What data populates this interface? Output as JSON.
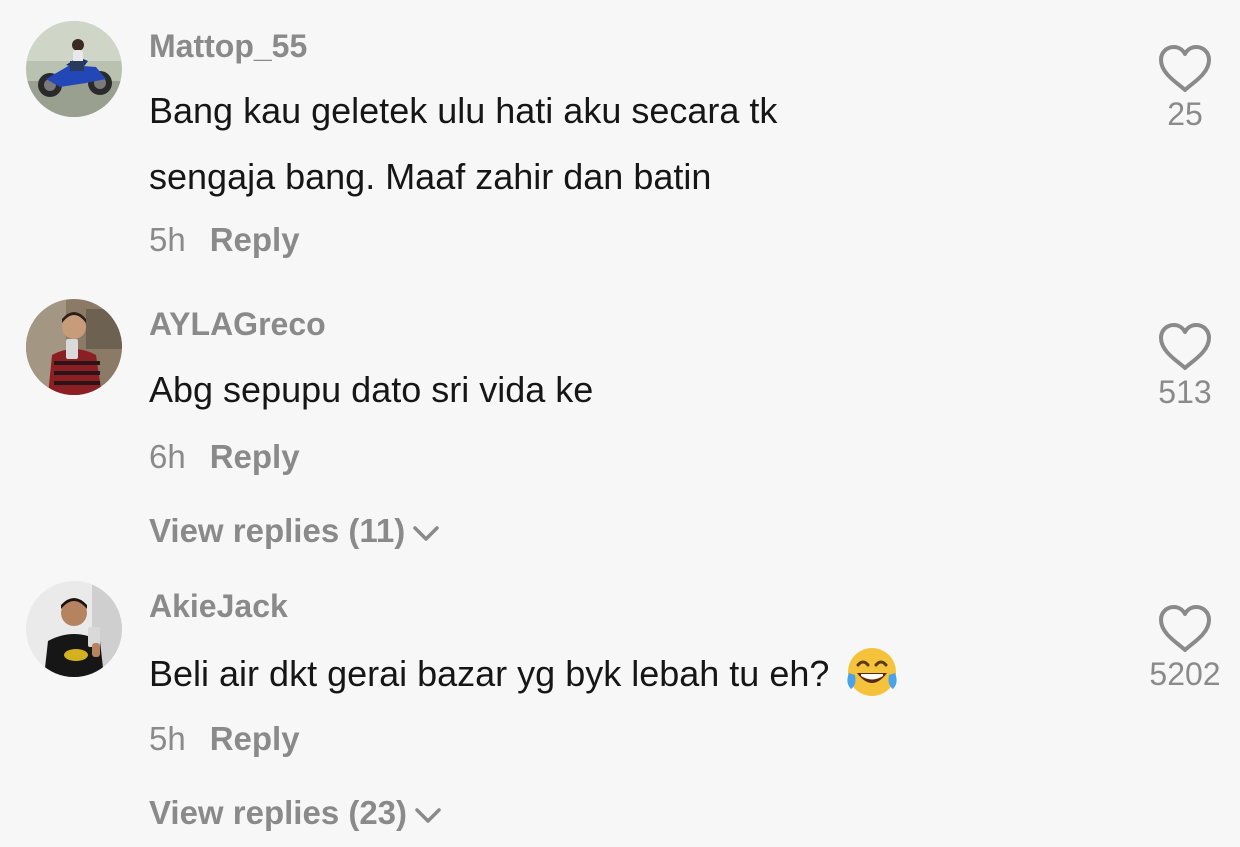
{
  "comments": [
    {
      "username": "Mattop_55",
      "text_lines": [
        "Bang kau geletek ulu hati aku secara tk",
        "sengaja bang. Maaf zahir dan batin"
      ],
      "time": "5h",
      "reply_label": "Reply",
      "likes": "25",
      "avatar_icon": "motorcycle-avatar"
    },
    {
      "username": "AYLAGreco",
      "text_lines": [
        "Abg sepupu dato sri vida ke"
      ],
      "time": "6h",
      "reply_label": "Reply",
      "likes": "513",
      "view_replies": "View replies (11)",
      "avatar_icon": "selfie-avatar"
    },
    {
      "username": "AkieJack",
      "text_lines": [
        "Beli air dkt gerai bazar yg byk lebah tu eh?"
      ],
      "time": "5h",
      "reply_label": "Reply",
      "likes": "5202",
      "view_replies": "View replies (23)",
      "emoji": "face-with-tears-of-joy",
      "avatar_icon": "selfie-avatar"
    }
  ],
  "colors": {
    "background": "#f7f7f7",
    "text": "#161616",
    "muted": "#8a8a8a"
  }
}
